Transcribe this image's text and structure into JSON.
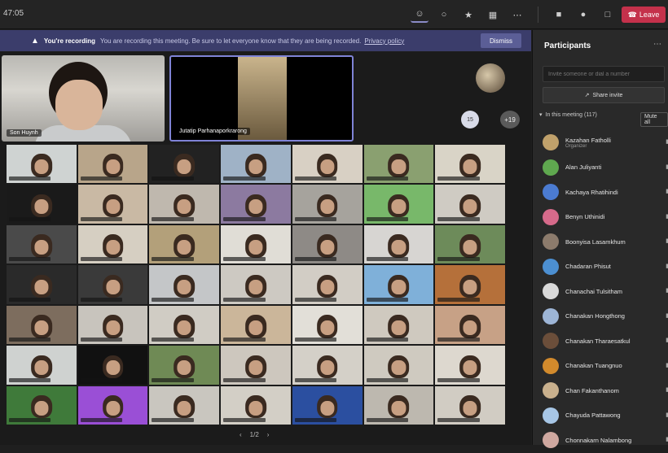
{
  "toolbar": {
    "timer": "47:05",
    "icons": [
      "people-icon",
      "chat-icon",
      "reactions-icon",
      "rooms-icon",
      "more-icon",
      "camera-icon",
      "mic-icon",
      "share-icon"
    ],
    "leave_label": "Leave"
  },
  "banner": {
    "title": "You're recording",
    "message": "You are recording this meeting. Be sure to let everyone know that they are being recorded.",
    "link": "Privacy policy",
    "dismiss": "Dismiss"
  },
  "stage": {
    "pinned": [
      {
        "label": "Son Huynh"
      },
      {
        "label": "Jutatip Parhanaporkrarong"
      }
    ],
    "overflow_a": "15",
    "overflow_b": "+19",
    "pager": {
      "prev": "‹",
      "page": "1/2",
      "next": "›"
    }
  },
  "panel": {
    "title": "Participants",
    "invite_placeholder": "Invite someone or dial a number",
    "share_label": "Share invite",
    "section_label": "In this meeting (117)",
    "mute_all": "Mute all",
    "participants": [
      {
        "name": "Kazahan Fatholli",
        "sub": "Organizer",
        "color": "#c0a16b"
      },
      {
        "name": "Alan Juliyanti",
        "sub": "",
        "color": "#5fa84f"
      },
      {
        "name": "Kachaya Rhatihindi",
        "sub": "",
        "color": "#4b7bd1"
      },
      {
        "name": "Benyn Uthinidi",
        "sub": "",
        "color": "#d66a8a"
      },
      {
        "name": "Boonyisa Lasamkhum",
        "sub": "",
        "color": "#8c7b6c"
      },
      {
        "name": "Chadaran Phisut",
        "sub": "",
        "color": "#4c8fd1"
      },
      {
        "name": "Chanachai Tulsitham",
        "sub": "",
        "color": "#d9d9d9"
      },
      {
        "name": "Chanakan Hongthong",
        "sub": "",
        "color": "#9db5d6"
      },
      {
        "name": "Chanakan Tharaesatkul",
        "sub": "",
        "color": "#6b4e3a"
      },
      {
        "name": "Chanakan Tuangnuo",
        "sub": "",
        "color": "#d28a2c"
      },
      {
        "name": "Chan Fakanthanom",
        "sub": "",
        "color": "#c9b08d"
      },
      {
        "name": "Chayuda Pattawong",
        "sub": "",
        "color": "#a7c6e6"
      },
      {
        "name": "Chonnakarn Nalambong",
        "sub": "",
        "color": "#cfa8a0"
      }
    ]
  }
}
